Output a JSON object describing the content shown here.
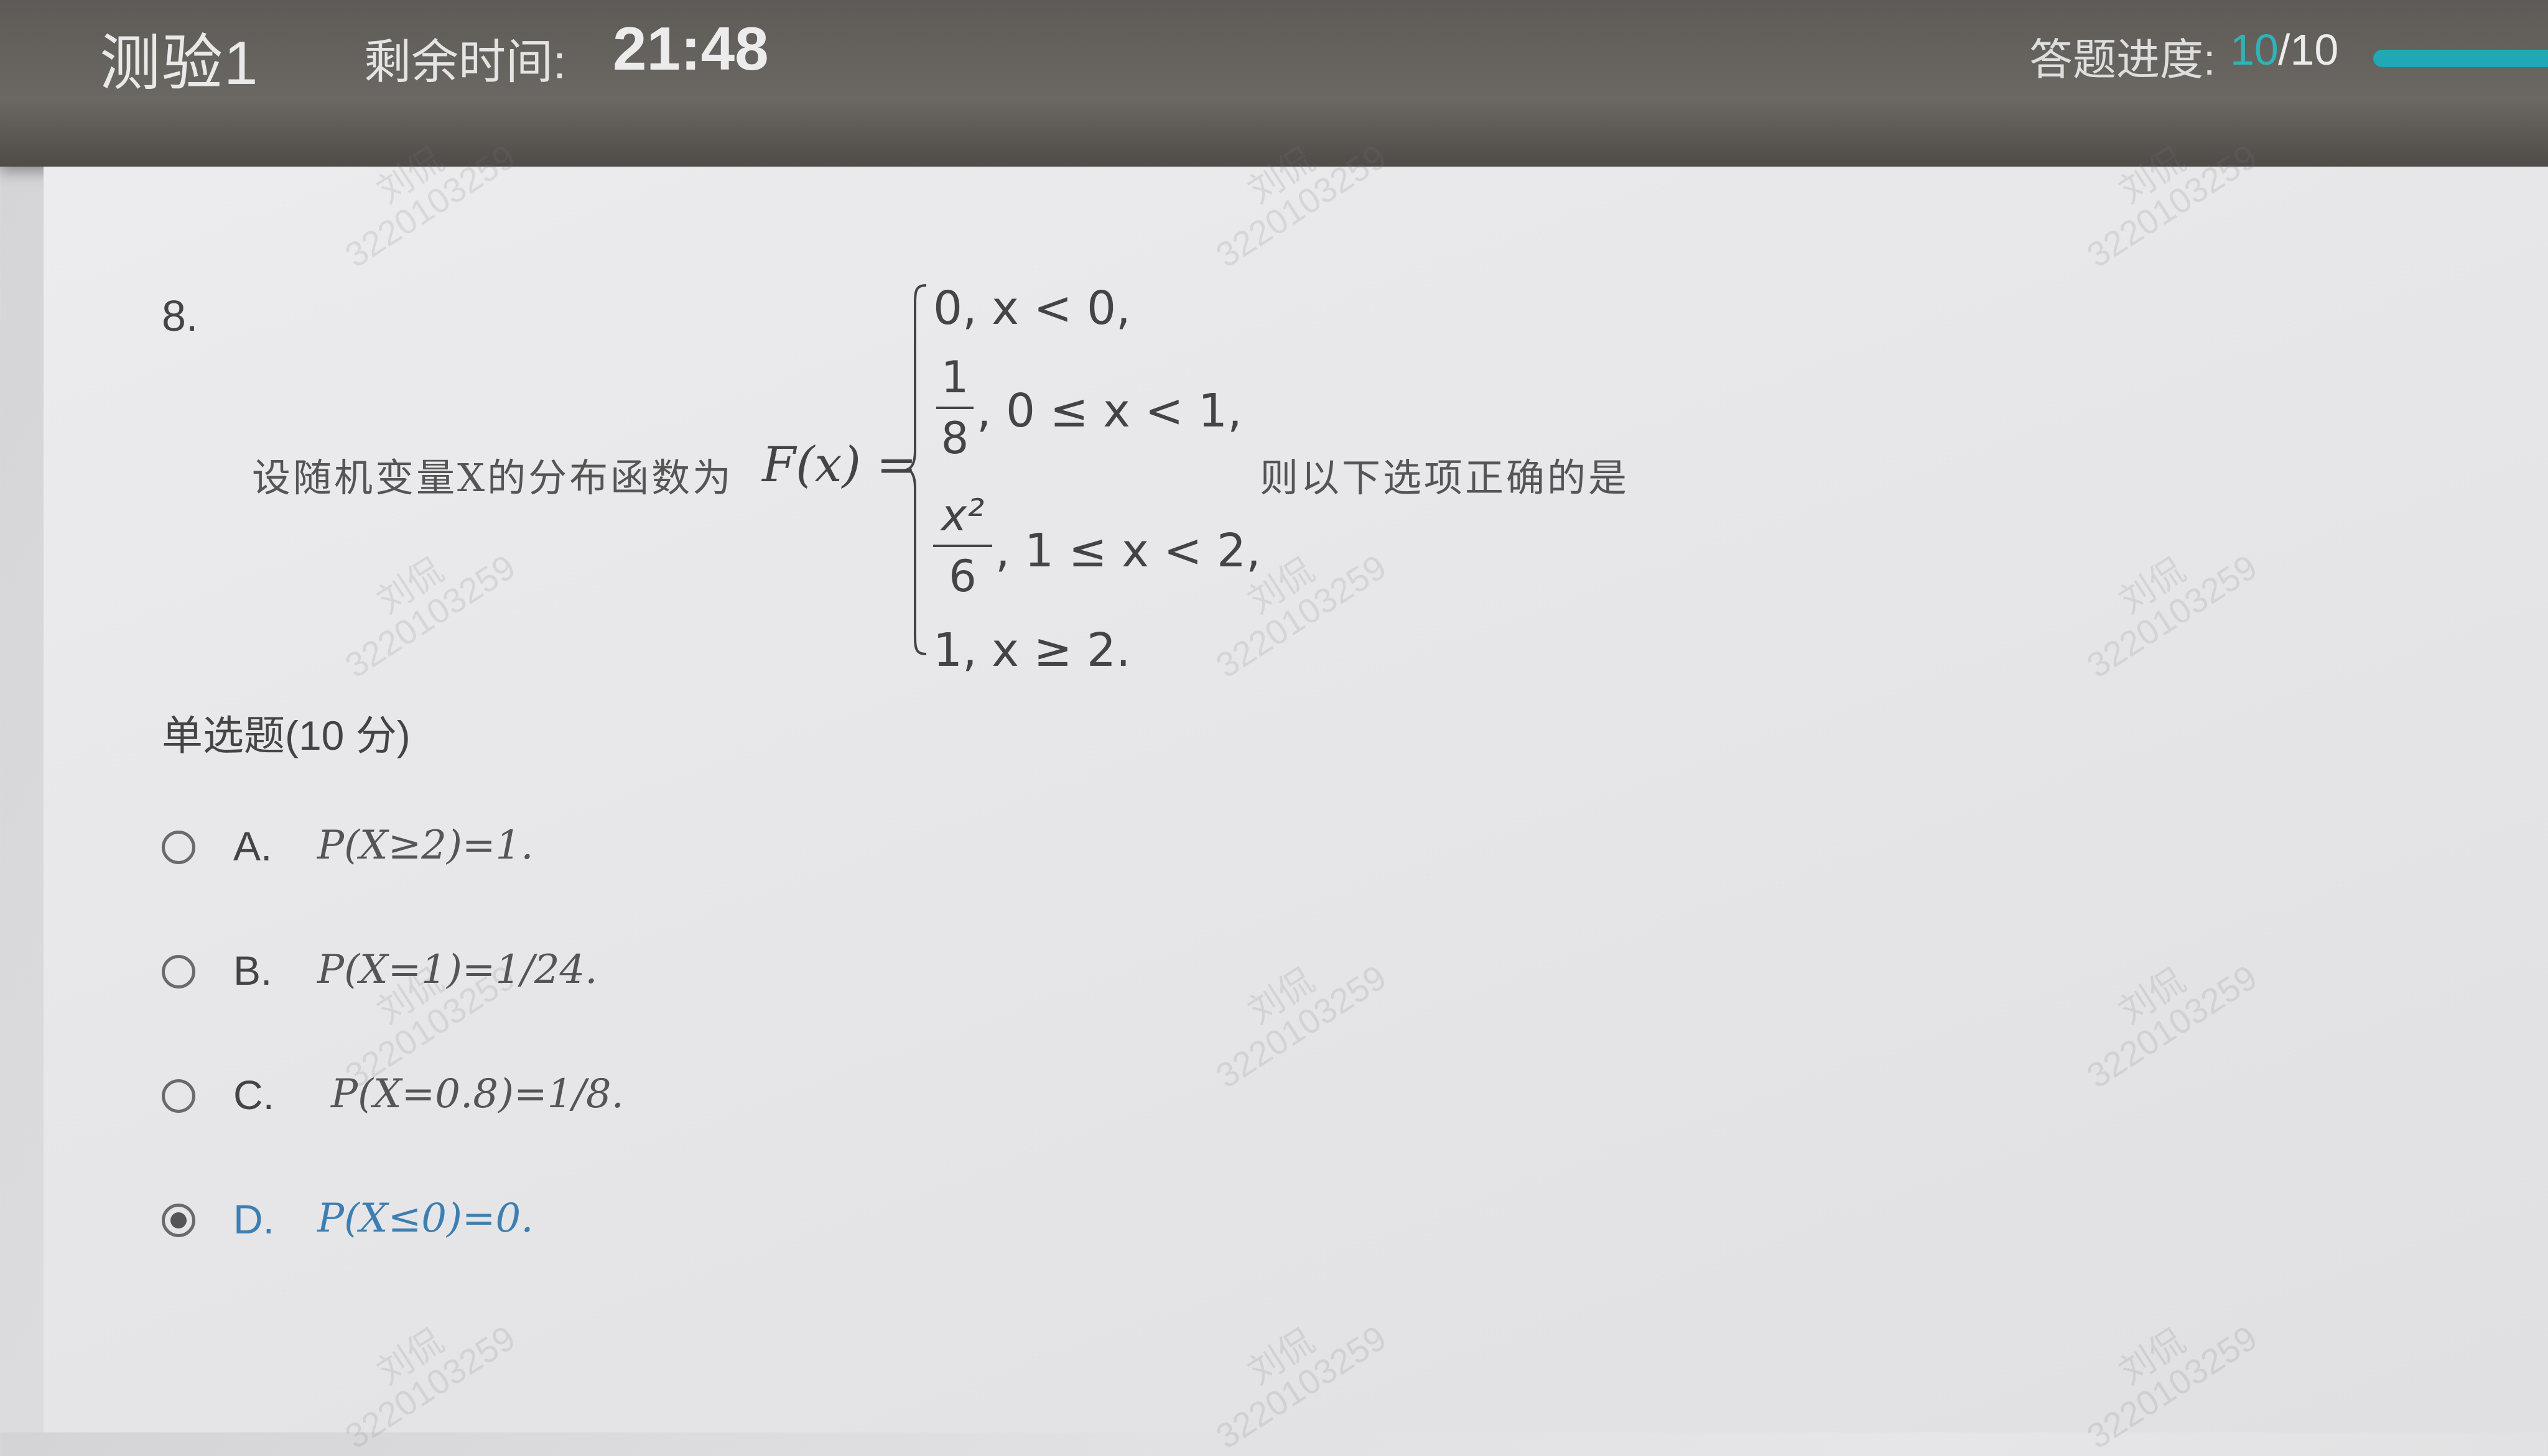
{
  "header": {
    "quiz_title": "测验1",
    "timer_label": "剩余时间:",
    "timer_value": "21:48",
    "progress_label": "答题进度:",
    "progress_current": "10",
    "progress_total": "/10",
    "progress_fraction": 1.0,
    "accent_color": "#21a8b6"
  },
  "question": {
    "number": "8.",
    "stem_prefix": "设随机变量X的分布函数为",
    "function_lhs": "F(x) =",
    "cases": {
      "case1": "0,   x < 0,",
      "case2_num": "1",
      "case2_den": "8",
      "case2_cond": ", 0 ≤ x < 1,",
      "case3_num": "x²",
      "case3_den": "6",
      "case3_cond": ", 1 ≤ x < 2,",
      "case4": "1,    x ≥ 2."
    },
    "stem_suffix": "则以下选项正确的是",
    "type_label": "单选题(10 分)"
  },
  "options": [
    {
      "letter": "A.",
      "text": "P(X≥2)=1."
    },
    {
      "letter": "B.",
      "text": "P(X=1)=1/24."
    },
    {
      "letter": "C.",
      "text": "P(X=0.8)=1/8."
    },
    {
      "letter": "D.",
      "text": "P(X≤0)=0."
    }
  ],
  "selected_option": "D",
  "watermark": {
    "name": "刘侃",
    "id": "3220103259"
  }
}
